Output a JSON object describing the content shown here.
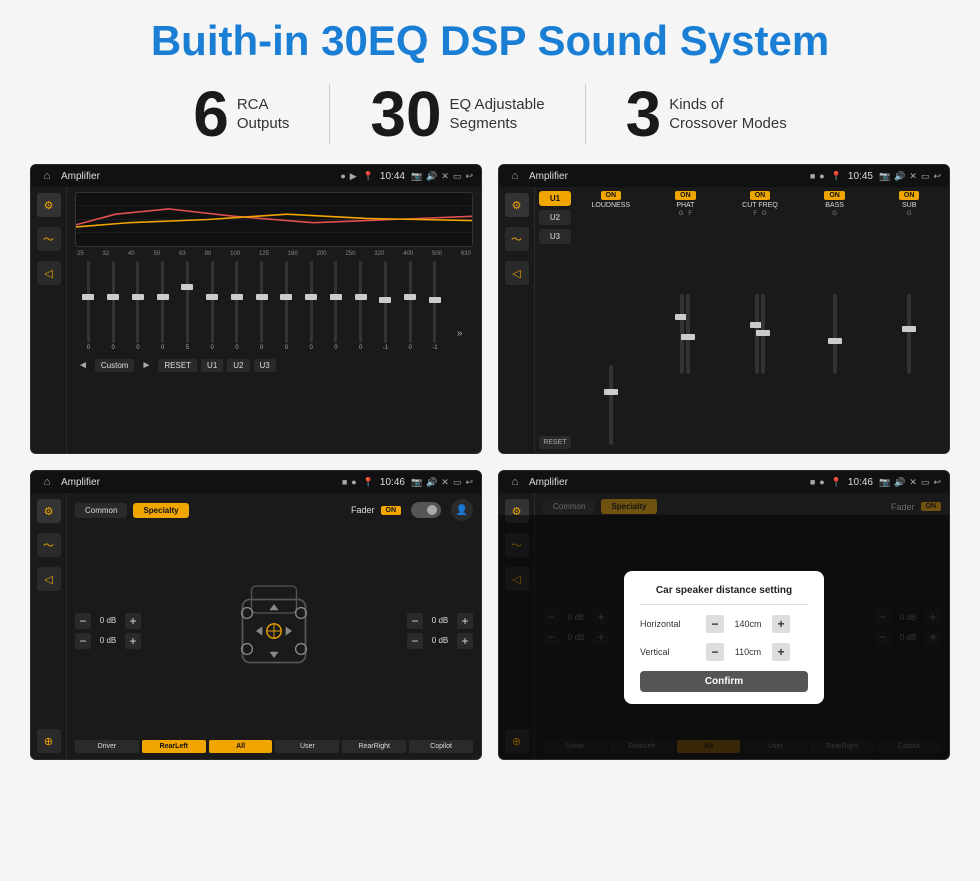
{
  "header": {
    "title": "Buith-in 30EQ DSP Sound System"
  },
  "stats": [
    {
      "number": "6",
      "line1": "RCA",
      "line2": "Outputs"
    },
    {
      "number": "30",
      "line1": "EQ Adjustable",
      "line2": "Segments"
    },
    {
      "number": "3",
      "line1": "Kinds of",
      "line2": "Crossover Modes"
    }
  ],
  "screens": [
    {
      "title": "Amplifier",
      "time": "10:44",
      "type": "eq"
    },
    {
      "title": "Amplifier",
      "time": "10:45",
      "type": "crossover"
    },
    {
      "title": "Amplifier",
      "time": "10:46",
      "type": "fader"
    },
    {
      "title": "Amplifier",
      "time": "10:46",
      "type": "fader-dialog"
    }
  ],
  "eq": {
    "freq_labels": [
      "25",
      "32",
      "40",
      "50",
      "63",
      "80",
      "100",
      "125",
      "160",
      "200",
      "250",
      "320",
      "400",
      "500",
      "630"
    ],
    "slider_values": [
      "0",
      "0",
      "0",
      "0",
      "5",
      "0",
      "0",
      "0",
      "0",
      "0",
      "0",
      "0",
      "-1",
      "0",
      "-1"
    ],
    "preset_label": "Custom",
    "buttons": [
      "RESET",
      "U1",
      "U2",
      "U3"
    ]
  },
  "crossover": {
    "presets": [
      "U1",
      "U2",
      "U3"
    ],
    "modules": [
      {
        "on": true,
        "label": "LOUDNESS"
      },
      {
        "on": true,
        "label": "PHAT"
      },
      {
        "on": true,
        "label": "CUT FREQ"
      },
      {
        "on": true,
        "label": "BASS"
      },
      {
        "on": true,
        "label": "SUB"
      }
    ],
    "reset_label": "RESET"
  },
  "fader": {
    "tabs": [
      "Common",
      "Specialty"
    ],
    "active_tab": "Specialty",
    "fader_label": "Fader",
    "on_label": "ON",
    "volumes": [
      {
        "value": "0 dB"
      },
      {
        "value": "0 dB"
      },
      {
        "value": "0 dB"
      },
      {
        "value": "0 dB"
      }
    ],
    "buttons": [
      "Driver",
      "RearLeft",
      "All",
      "User",
      "RearRight",
      "Copilot"
    ]
  },
  "dialog": {
    "title": "Car speaker distance setting",
    "horizontal_label": "Horizontal",
    "horizontal_value": "140cm",
    "vertical_label": "Vertical",
    "vertical_value": "110cm",
    "confirm_label": "Confirm"
  }
}
